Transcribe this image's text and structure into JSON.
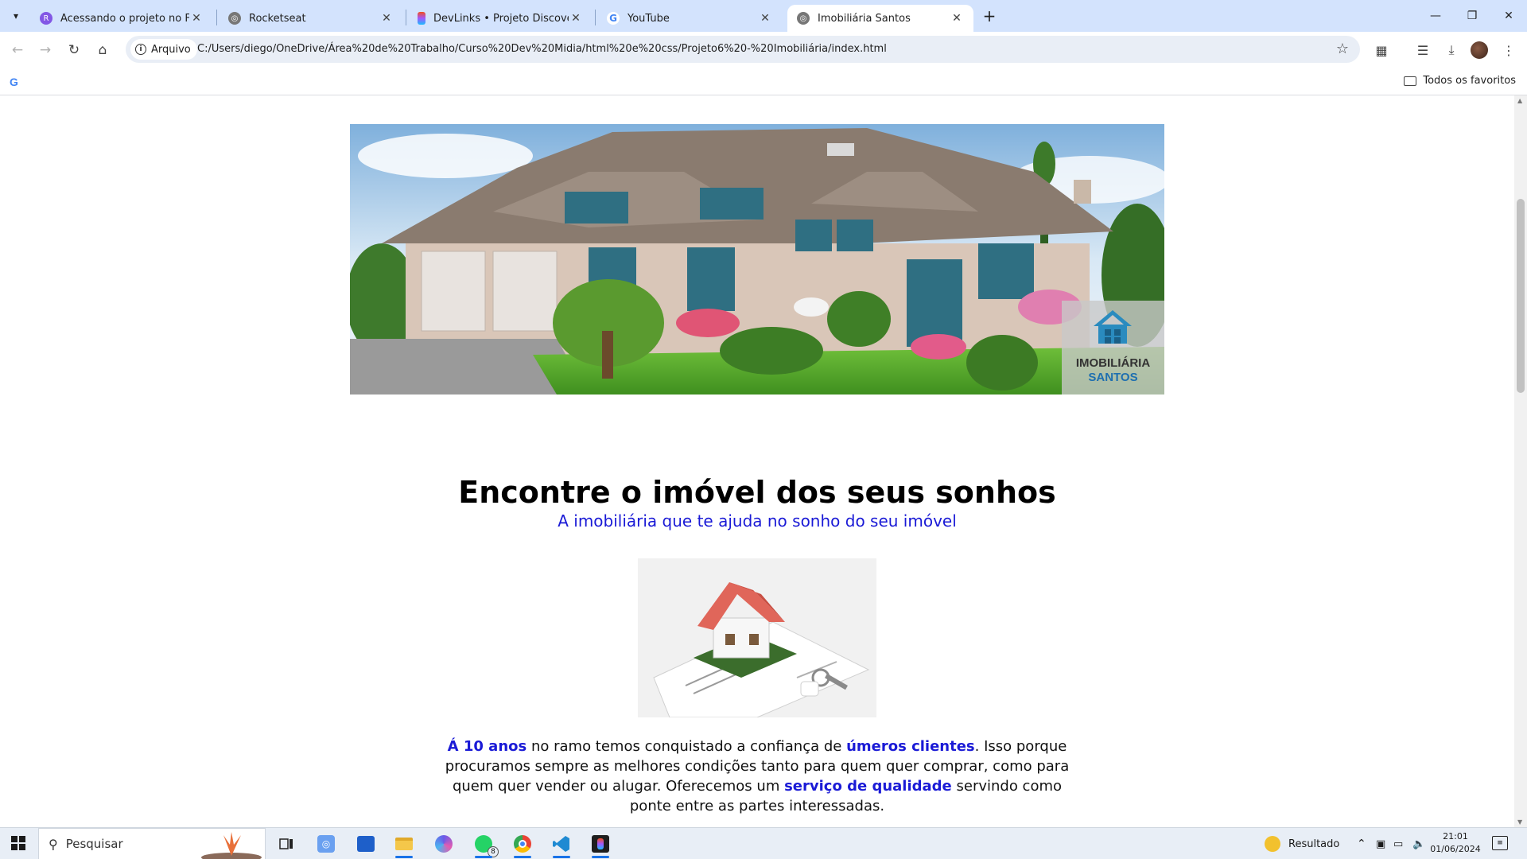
{
  "browser": {
    "tabs": [
      {
        "title": "Acessando o projeto no Figma",
        "favicon": "rocketseat-icon"
      },
      {
        "title": "Rocketseat",
        "favicon": "globe-icon"
      },
      {
        "title": "DevLinks • Projeto Discover (",
        "favicon": "figma-icon"
      },
      {
        "title": "YouTube",
        "favicon": "google-icon"
      },
      {
        "title": "Imobiliária Santos",
        "favicon": "globe-icon"
      }
    ],
    "active_tab_index": 4,
    "site_chip": "Arquivo",
    "url": "C:/Users/diego/OneDrive/Área%20de%20Trabalho/Curso%20Dev%20Midia/html%20e%20css/Projeto6%20-%20Imobiliária/index.html",
    "bookmarks_all": "Todos os favoritos"
  },
  "page": {
    "hero_logo_line1": "IMOBILIÁRIA",
    "hero_logo_line2": "SANTOS",
    "headline": "Encontre o imóvel dos seus sonhos",
    "subheadline": "A imobiliária que te ajuda no sonho do seu imóvel",
    "paragraph": {
      "hl1": "Á 10 anos",
      "t1": " no ramo temos conquistado a confiança de ",
      "hl2": "úmeros clientes",
      "t2": ". Isso porque procuramos sempre as melhores condições tanto para quem quer comprar, como para quem quer vender ou alugar. Oferecemos um ",
      "hl3": "serviço de qualidade",
      "t3": " servindo como ponte entre as partes interessadas."
    },
    "accent_color": "#1a1ad6"
  },
  "taskbar": {
    "search_placeholder": "Pesquisar",
    "whatsapp_badge": "8",
    "weather_label": "Resultado",
    "time": "21:01",
    "date": "01/06/2024"
  }
}
